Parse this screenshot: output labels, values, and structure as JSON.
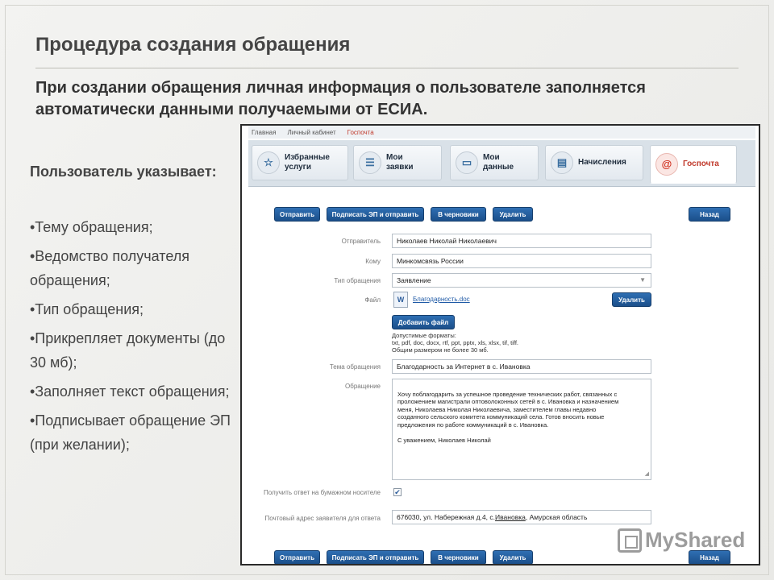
{
  "slide": {
    "title": "Процедура создания обращения",
    "subtitle": "При создании обращения личная информация о пользователе заполняется автоматически данными получаемыми от ЕСИА.",
    "left_heading": "Пользователь указывает:",
    "bullets": [
      "•Тему обращения;",
      "•Ведомство получателя обращения;",
      "•Тип обращения;",
      "•Прикрепляет документы (до 30 мб);",
      "•Заполняет текст обращения;",
      "•Подписывает обращение ЭП (при желании);"
    ]
  },
  "portal": {
    "breadcrumbs": [
      "Главная",
      "Личный кабинет",
      "Госпочта"
    ],
    "nav_tabs": [
      {
        "label": "Избранные\nуслуги",
        "icon": "star-hand-icon"
      },
      {
        "label": "Мои\nзаявки",
        "icon": "list-icon"
      },
      {
        "label": "Мои\nданные",
        "icon": "id-card-icon"
      },
      {
        "label": "Начисления",
        "icon": "payments-icon"
      },
      {
        "label": "Госпочта",
        "icon": "at-mail-icon"
      }
    ],
    "toolbar": {
      "send": "Отправить",
      "sign_send": "Подписать ЭП и отправить",
      "draft": "В черновики",
      "delete": "Удалить",
      "back": "Назад"
    },
    "form": {
      "sender_label": "Отправитель",
      "sender_value": "Николаев Николай Николаевич",
      "to_label": "Кому",
      "to_value": "Минкомсвязь России",
      "type_label": "Тип обращения",
      "type_value": "Заявление",
      "file_label": "Файл",
      "file_icon_text": "W",
      "file_name": "Благодарность.doc",
      "file_delete": "Удалить",
      "add_file": "Добавить файл",
      "formats_note": "Допустимые форматы:\ntxt, pdf, doc, docx, rtf, ppt, pptx, xls, xlsx, tif, tiff.\nОбщим размером не более 30 мб.",
      "subject_label": "Тема обращения",
      "subject_value": "Благодарность за Интернет в с. Ивановка",
      "message_label": "Обращение",
      "message_text": "Хочу поблагодарить за успешное проведение технических работ, связанных с\nпроложением магистрали оптоволоконных сетей в с. Ивановка и назначением\nменя, Николаева Николая Николаевича, заместителем главы недавно\nсозданного сельского комитета коммуникаций села. Готов вносить новые\nпредложения по работе коммуникаций в с. Ивановка.\n\nС уважением, Николаев Николай",
      "paper_label": "Получить ответ на бумажном\nносителе",
      "paper_checked": "✔",
      "address_label": "Почтовый адрес заявителя\nдля ответа",
      "address_prefix": "676030, ул. Набережная д.4, с. ",
      "address_link": "Ивановка",
      "address_suffix": ", Амурская область"
    }
  },
  "watermark": {
    "brand": "MyShared"
  }
}
